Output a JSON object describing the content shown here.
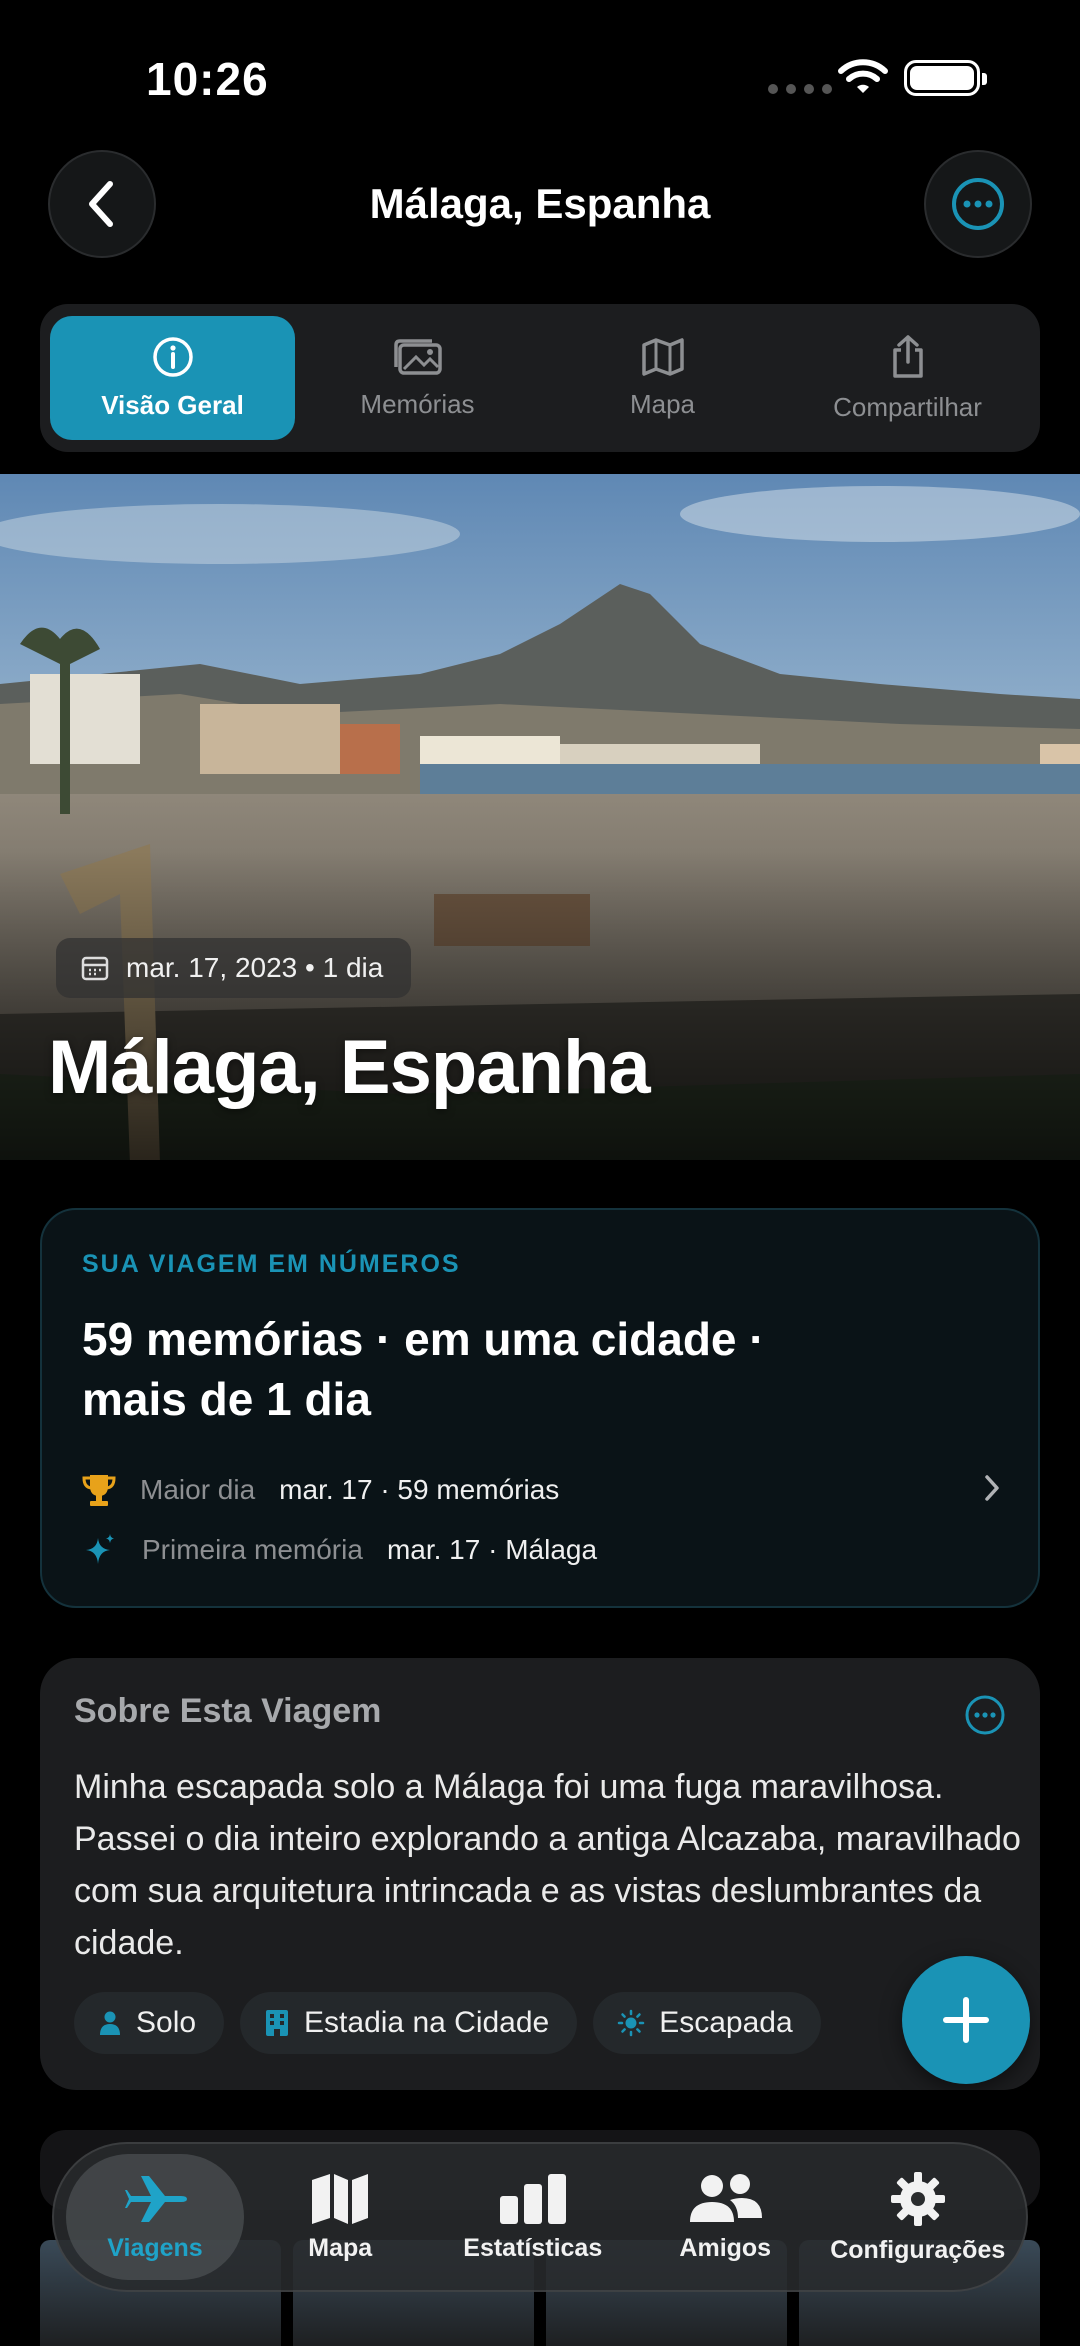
{
  "status_bar": {
    "time": "10:26"
  },
  "header": {
    "title": "Málaga, Espanha"
  },
  "segments": [
    {
      "label": "Visão Geral",
      "icon": "info-icon",
      "active": true
    },
    {
      "label": "Memórias",
      "icon": "photos-icon",
      "active": false
    },
    {
      "label": "Mapa",
      "icon": "map-icon",
      "active": false
    },
    {
      "label": "Compartilhar",
      "icon": "share-icon",
      "active": false
    }
  ],
  "hero": {
    "date": "mar. 17, 2023 • 1 dia",
    "title": "Málaga, Espanha"
  },
  "numbers": {
    "kicker": "SUA VIAGEM EM NÚMEROS",
    "summary": "59 memórias · em uma cidade · mais de 1 dia",
    "rows": [
      {
        "label": "Maior dia",
        "value": "mar. 17 · 59 memórias",
        "icon": "trophy-icon"
      },
      {
        "label": "Primeira memória",
        "value": "mar. 17 · Málaga",
        "icon": "sparkles-icon"
      }
    ]
  },
  "about": {
    "title": "Sobre Esta Viagem",
    "text": "Minha escapada solo a Málaga foi uma fuga maravilhosa. Passei o dia inteiro explorando a antiga Alcazaba, maravilhado com sua arquitetura intrincada e as vistas deslumbrantes da cidade.",
    "tags": [
      {
        "label": "Solo",
        "icon": "person-icon"
      },
      {
        "label": "Estadia na Cidade",
        "icon": "building-icon"
      },
      {
        "label": "Escapada",
        "icon": "sun-icon"
      }
    ]
  },
  "tabbar": [
    {
      "label": "Viagens",
      "icon": "airplane-icon",
      "active": true
    },
    {
      "label": "Mapa",
      "icon": "map-icon",
      "active": false
    },
    {
      "label": "Estatísticas",
      "icon": "bar-chart-icon",
      "active": false
    },
    {
      "label": "Amigos",
      "icon": "people-icon",
      "active": false
    },
    {
      "label": "Configurações",
      "icon": "gear-icon",
      "active": false
    }
  ],
  "colors": {
    "accent": "#1a93b5",
    "background": "#000000",
    "card": "#1c1d1f"
  }
}
